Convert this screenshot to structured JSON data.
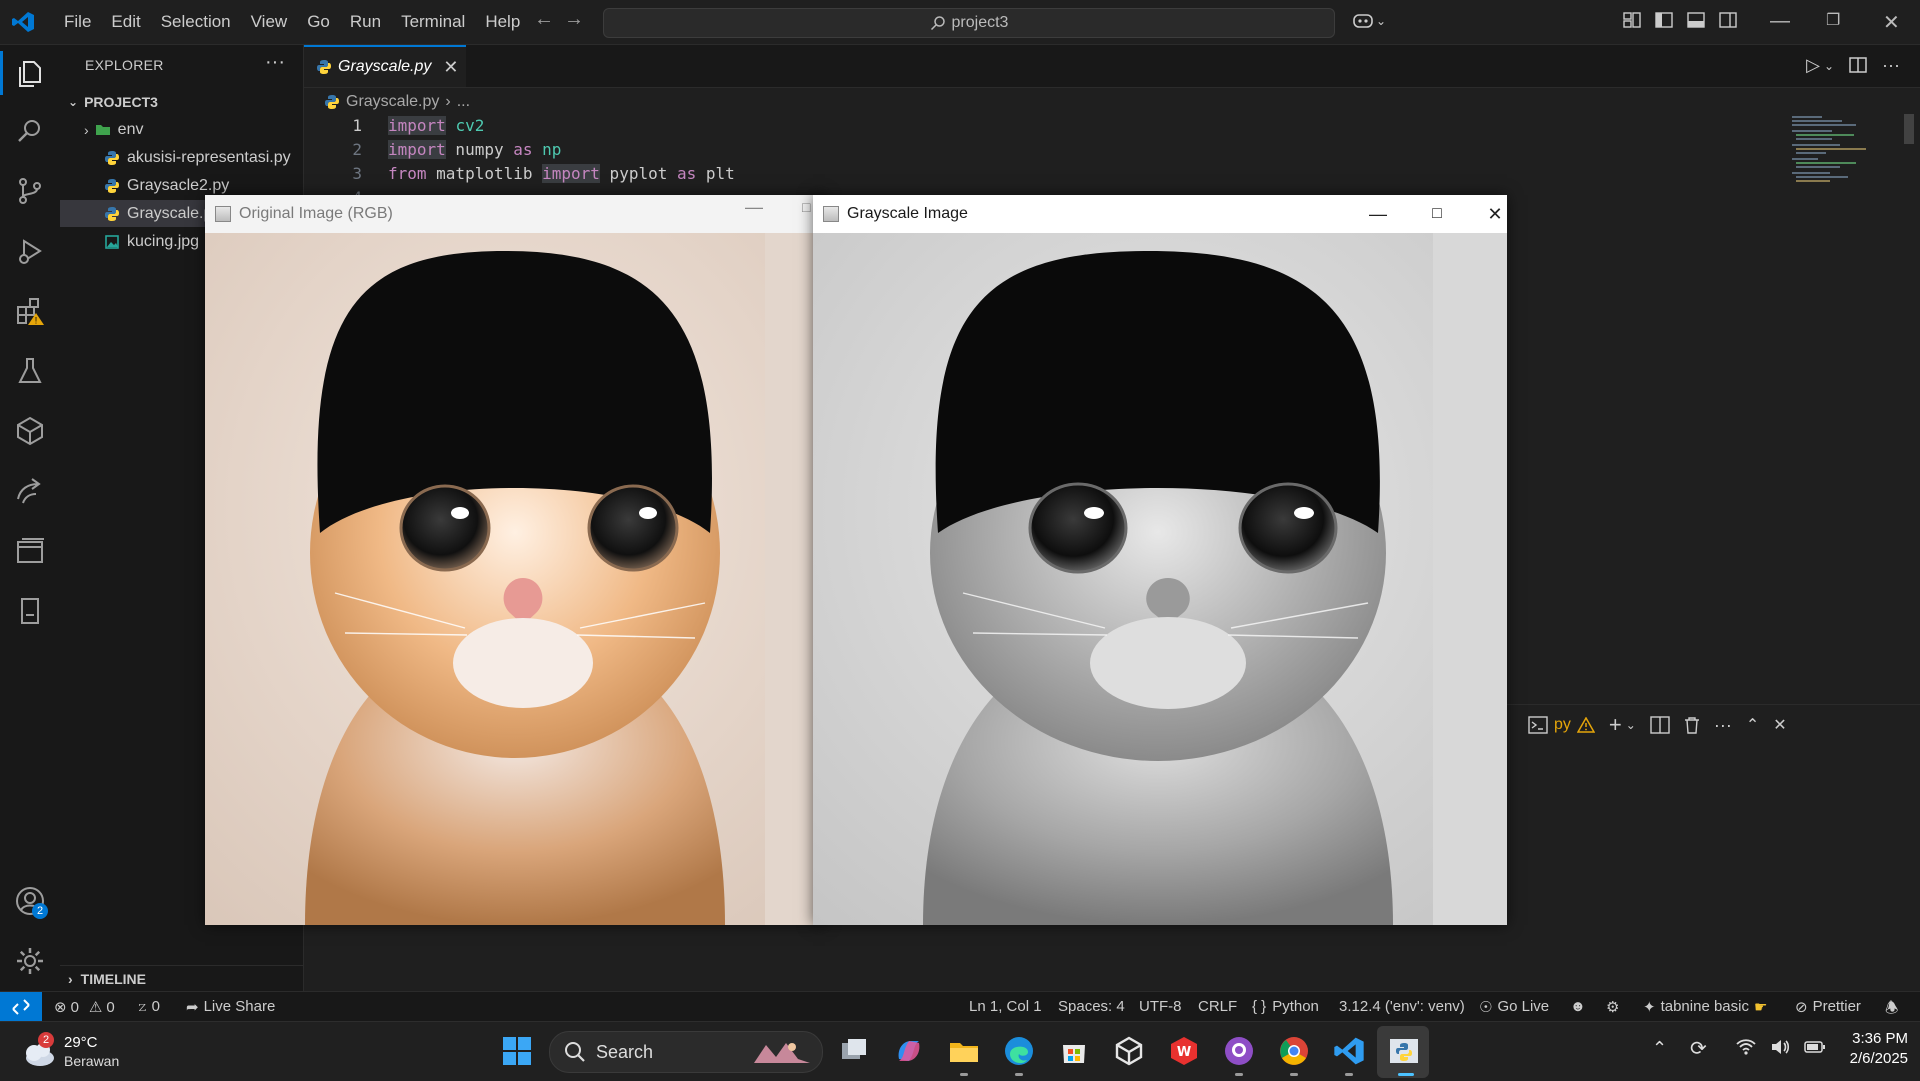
{
  "titlebar": {
    "menu": [
      "File",
      "Edit",
      "Selection",
      "View",
      "Go",
      "Run",
      "Terminal",
      "Help"
    ],
    "command_center": "project3"
  },
  "sidebar": {
    "title": "EXPLORER",
    "project": "PROJECT3",
    "items": [
      {
        "label": "env",
        "type": "folder"
      },
      {
        "label": "akusisi-representasi.py",
        "type": "python"
      },
      {
        "label": "Graysacle2.py",
        "type": "python"
      },
      {
        "label": "Grayscale.py",
        "type": "python"
      },
      {
        "label": "kucing.jpg",
        "type": "image"
      }
    ],
    "timeline": "TIMELINE"
  },
  "activity_badges": {
    "accounts": "2"
  },
  "editor": {
    "tab": "Grayscale.py",
    "breadcrumb": {
      "file": "Grayscale.py",
      "rest": "..."
    },
    "lines": [
      {
        "n": "1",
        "parts": [
          {
            "t": "import",
            "c": "kw hl"
          },
          {
            "t": " ",
            "c": ""
          },
          {
            "t": "cv2",
            "c": "mod"
          }
        ]
      },
      {
        "n": "2",
        "parts": [
          {
            "t": "import",
            "c": "kw hl"
          },
          {
            "t": " numpy ",
            "c": ""
          },
          {
            "t": "as",
            "c": "kw"
          },
          {
            "t": " ",
            "c": ""
          },
          {
            "t": "np",
            "c": "mod"
          }
        ]
      },
      {
        "n": "3",
        "parts": [
          {
            "t": "from",
            "c": "kw"
          },
          {
            "t": " matplotlib ",
            "c": ""
          },
          {
            "t": "import",
            "c": "kw hl"
          },
          {
            "t": " pyplot ",
            "c": ""
          },
          {
            "t": "as",
            "c": "kw"
          },
          {
            "t": " plt",
            "c": ""
          }
        ]
      },
      {
        "n": "4",
        "parts": []
      }
    ]
  },
  "panel": {
    "terminal_label": "py"
  },
  "windows": {
    "original": {
      "title": "Original Image (RGB)"
    },
    "grayscale": {
      "title": "Grayscale Image"
    }
  },
  "statusbar": {
    "errors": "0",
    "warnings": "0",
    "ports": "0",
    "live_share": "Live Share",
    "position": "Ln 1, Col 1",
    "spaces": "Spaces: 4",
    "encoding": "UTF-8",
    "eol": "CRLF",
    "language": "Python",
    "interpreter": "3.12.4 ('env': venv)",
    "go_live": "Go Live",
    "tabnine": "tabnine basic",
    "prettier": "Prettier"
  },
  "taskbar": {
    "weather_temp": "29°C",
    "weather_desc": "Berawan",
    "weather_badge": "2",
    "search": "Search",
    "time": "3:36 PM",
    "date": "2/6/2025"
  },
  "colors": {
    "accent": "#0078d4",
    "editor_bg": "#1f1f1f",
    "chrome_bg": "#181818"
  }
}
